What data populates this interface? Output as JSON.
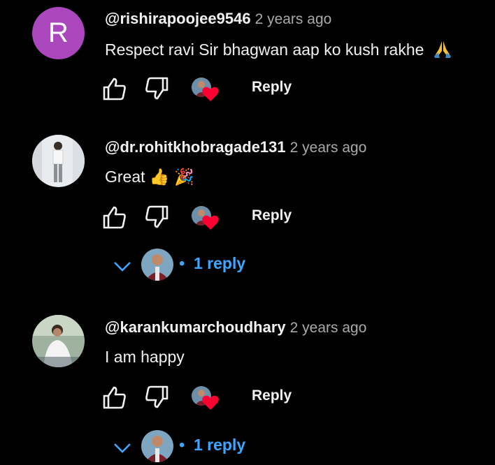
{
  "comments": [
    {
      "author": "@rishirapoojee9546",
      "time": "2 years ago",
      "text": "Respect ravi Sir bhagwan aap ko kush rakhe",
      "avatar_letter": "R",
      "avatar_color": "#ab47bc",
      "reply_label": "Reply"
    },
    {
      "author": "@dr.rohitkhobragade131",
      "time": "2 years ago",
      "text": "Great 👍 🎉",
      "reply_label": "Reply",
      "replies_label": "1 reply"
    },
    {
      "author": "@karankumarchoudhary",
      "time": "2 years ago",
      "text": "I am happy",
      "reply_label": "Reply",
      "replies_label": "1 reply"
    }
  ],
  "icons": {
    "like": "thumbs-up-icon",
    "dislike": "thumbs-down-icon",
    "creator_heart": "heart-icon",
    "expand": "chevron-down-icon",
    "folded_hands": "folded-hands-emoji"
  },
  "colors": {
    "background": "#000000",
    "text": "#f1f1f1",
    "secondary_text": "#aaaaaa",
    "link": "#3ea6ff",
    "heart": "#ff0033"
  }
}
